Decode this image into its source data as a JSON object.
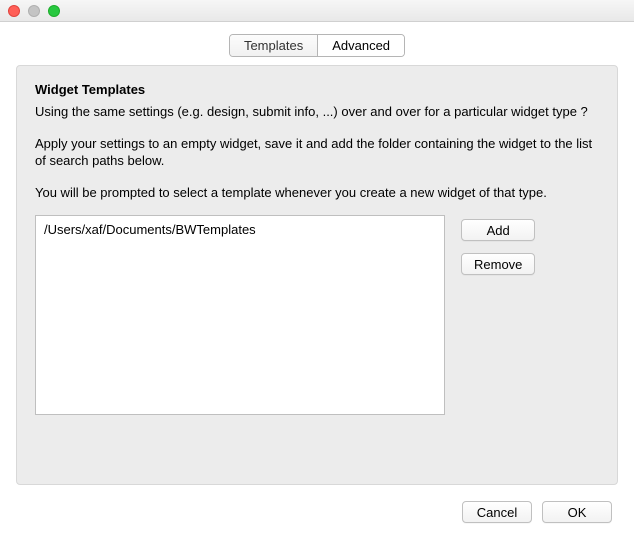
{
  "tabs": {
    "templates": "Templates",
    "advanced": "Advanced",
    "active": "advanced"
  },
  "section": {
    "title": "Widget Templates",
    "para1": "Using the same settings (e.g. design, submit info, ...) over and over for a particular widget type ?",
    "para2": "Apply your settings to an empty widget, save it and add the folder containing the widget to the list of search paths below.",
    "para3": "You will be prompted to select a template whenever you create a new widget of that type."
  },
  "paths": {
    "items": [
      "/Users/xaf/Documents/BWTemplates"
    ]
  },
  "buttons": {
    "add": "Add",
    "remove": "Remove",
    "cancel": "Cancel",
    "ok": "OK"
  }
}
